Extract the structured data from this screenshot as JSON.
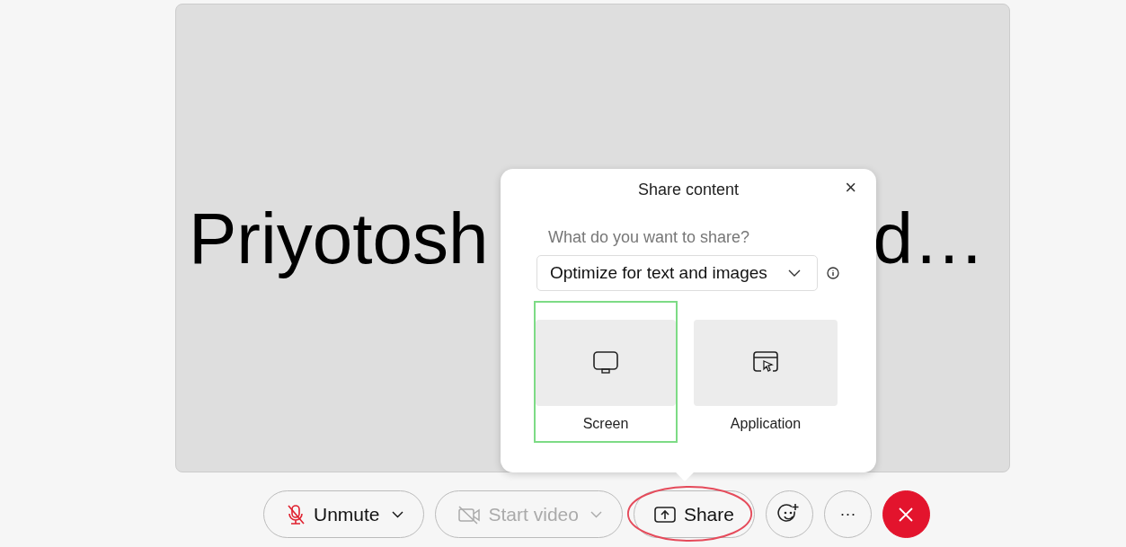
{
  "stage": {
    "name_start": "Priyotosh",
    "name_end": "d…"
  },
  "share_dialog": {
    "title": "Share content",
    "close": "×",
    "question": "What do you want to share?",
    "quality": {
      "value": "Optimize for text and images"
    },
    "options": [
      {
        "kind": "screen",
        "label": "Screen",
        "selected": true
      },
      {
        "kind": "application",
        "label": "Application",
        "selected": false
      }
    ]
  },
  "controls": [
    {
      "kind": "mic",
      "label": "Unmute",
      "muted": true,
      "disabled": false,
      "dropdown": true,
      "highlighted": false
    },
    {
      "kind": "video",
      "label": "Start video",
      "muted": true,
      "disabled": true,
      "dropdown": true,
      "highlighted": false
    },
    {
      "kind": "share",
      "label": "Share",
      "disabled": false,
      "dropdown": false,
      "highlighted": true
    },
    {
      "kind": "reaction",
      "disabled": false
    },
    {
      "kind": "more",
      "label": "···",
      "disabled": false
    },
    {
      "kind": "leave",
      "disabled": false
    }
  ]
}
